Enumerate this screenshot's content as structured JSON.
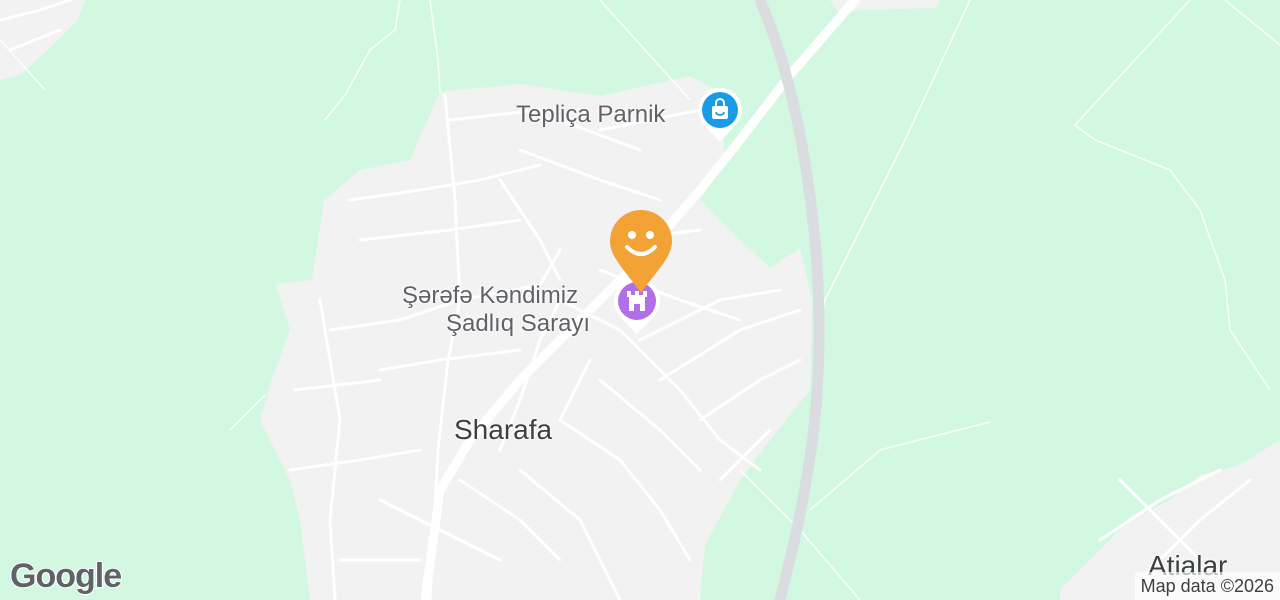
{
  "map": {
    "background_color": "#d3f8e2",
    "settlement_color": "#f2f2f2",
    "road_color": "#ffffff",
    "highway_color": "#dadce0"
  },
  "pois": {
    "shop": {
      "name": "Tepliça Parnik",
      "icon": "shopping-bag-icon",
      "color": "#1a9be8"
    },
    "wedding_hall": {
      "name_line1": "Şərəfə Kəndimiz",
      "name_line2": "Şadlıq Sarayı",
      "icon": "castle-icon",
      "color": "#b26fe8"
    },
    "selected": {
      "icon": "smiley-face-icon",
      "color": "#f3a235"
    }
  },
  "places": {
    "sharafa": "Sharafa",
    "atialar": "Atialar"
  },
  "footer": {
    "logo": "Google",
    "attribution": "Map data ©2026"
  }
}
